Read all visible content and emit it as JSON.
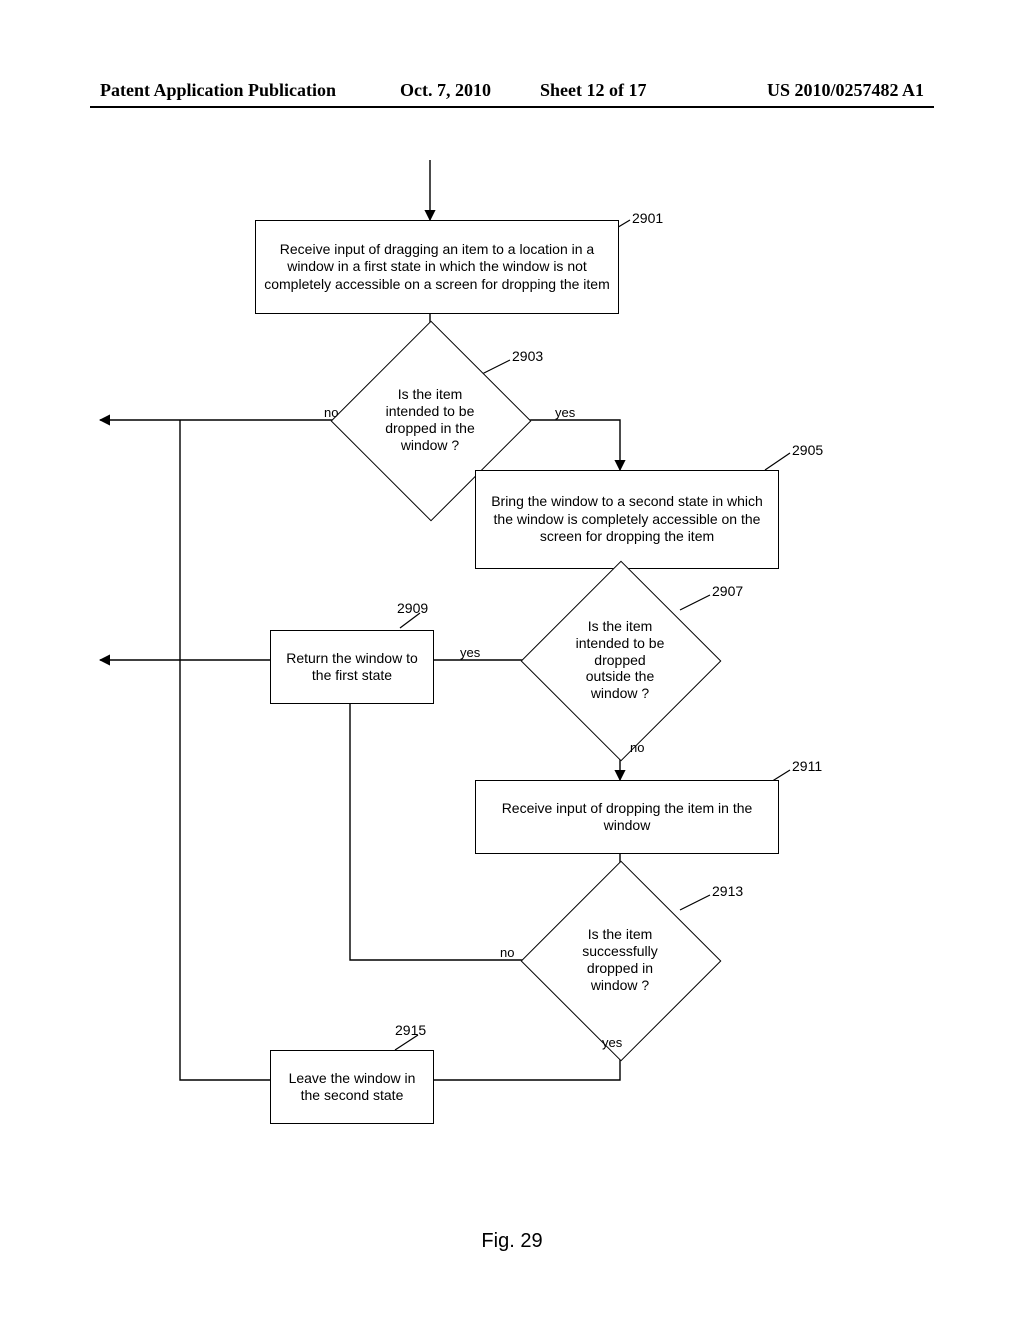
{
  "header": {
    "left": "Patent Application Publication",
    "date": "Oct. 7, 2010",
    "sheet": "Sheet 12 of 17",
    "pubno": "US 2010/0257482 A1"
  },
  "figure_caption": "Fig. 29",
  "nodes": {
    "n2901": {
      "ref": "2901",
      "text": "Receive input of dragging an item to a location in a window in a first state in which the window is not completely accessible on a screen for dropping the item"
    },
    "n2903": {
      "ref": "2903",
      "text": "Is the item intended to be dropped in the window ?"
    },
    "n2905": {
      "ref": "2905",
      "text": "Bring the window to a second state in which the window is completely accessible on the screen for dropping the item"
    },
    "n2907": {
      "ref": "2907",
      "text": "Is the item intended to be dropped outside the window ?"
    },
    "n2909": {
      "ref": "2909",
      "text": "Return the window to the first state"
    },
    "n2911": {
      "ref": "2911",
      "text": "Receive input of dropping the item in the window"
    },
    "n2913": {
      "ref": "2913",
      "text": "Is the item successfully dropped in window ?"
    },
    "n2915": {
      "ref": "2915",
      "text": "Leave the window in the second state"
    }
  },
  "edge_labels": {
    "yes": "yes",
    "no": "no"
  },
  "chart_data": {
    "type": "flowchart",
    "nodes": [
      {
        "id": "2901",
        "kind": "process",
        "text": "Receive input of dragging an item to a location in a window in a first state in which the window is not completely accessible on a screen for dropping the item"
      },
      {
        "id": "2903",
        "kind": "decision",
        "text": "Is the item intended to be dropped in the window ?"
      },
      {
        "id": "2905",
        "kind": "process",
        "text": "Bring the window to a second state in which the window is completely accessible on the screen for dropping the item"
      },
      {
        "id": "2907",
        "kind": "decision",
        "text": "Is the item intended to be dropped outside the window ?"
      },
      {
        "id": "2909",
        "kind": "process",
        "text": "Return the window to the first state"
      },
      {
        "id": "2911",
        "kind": "process",
        "text": "Receive input of dropping the item in the window"
      },
      {
        "id": "2913",
        "kind": "decision",
        "text": "Is the item successfully dropped in window ?"
      },
      {
        "id": "2915",
        "kind": "process",
        "text": "Leave the window in the second state"
      }
    ],
    "edges": [
      {
        "from": "start",
        "to": "2901"
      },
      {
        "from": "2901",
        "to": "2903"
      },
      {
        "from": "2903",
        "to": "exit_left",
        "label": "no"
      },
      {
        "from": "2903",
        "to": "2905",
        "label": "yes"
      },
      {
        "from": "2905",
        "to": "2907"
      },
      {
        "from": "2907",
        "to": "2909",
        "label": "yes"
      },
      {
        "from": "2909",
        "to": "exit_left"
      },
      {
        "from": "2907",
        "to": "2911",
        "label": "no"
      },
      {
        "from": "2911",
        "to": "2913"
      },
      {
        "from": "2913",
        "to": "2909",
        "label": "no"
      },
      {
        "from": "2913",
        "to": "2915",
        "label": "yes"
      },
      {
        "from": "2915",
        "to": "exit_left"
      }
    ]
  }
}
